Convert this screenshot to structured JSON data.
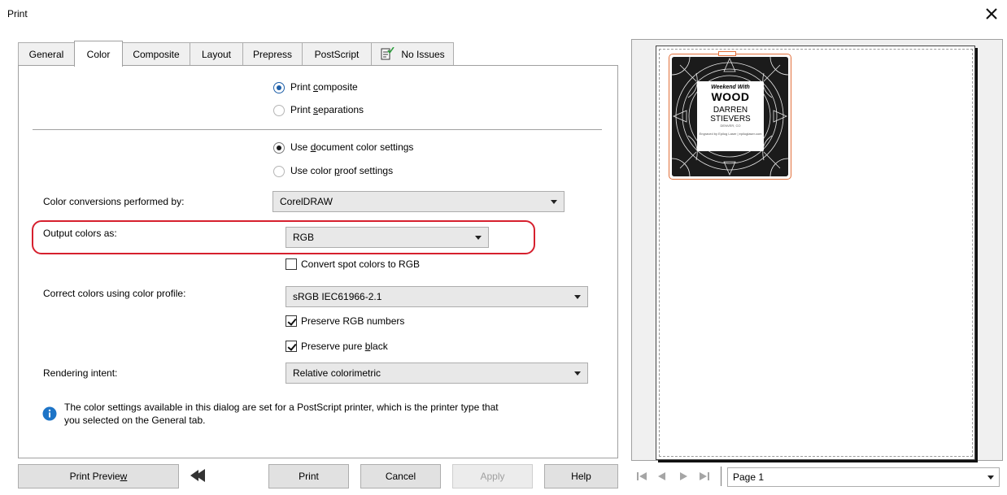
{
  "window": {
    "title": "Print",
    "close_icon": "close-icon"
  },
  "tabs": [
    {
      "label": "General",
      "active": false
    },
    {
      "label": "Color",
      "active": true
    },
    {
      "label": "Composite",
      "active": false
    },
    {
      "label": "Layout",
      "active": false
    },
    {
      "label": "Prepress",
      "active": false
    },
    {
      "label": "PostScript",
      "active": false
    },
    {
      "label": "No Issues",
      "active": false,
      "icon": "issues-check-icon"
    }
  ],
  "color_tab": {
    "print_mode": {
      "composite_pre": "Print ",
      "composite_u": "c",
      "composite_post": "omposite",
      "separations_pre": "Print ",
      "separations_u": "s",
      "separations_post": "eparations",
      "selected": "composite"
    },
    "settings_source": {
      "document_pre": "Use ",
      "document_u": "d",
      "document_post": "ocument color settings",
      "proof_pre": "Use color ",
      "proof_u": "p",
      "proof_post": "roof settings",
      "selected": "document"
    },
    "conversions_label": "Color conversions performed by:",
    "conversions_value": "CorelDRAW",
    "output_label": "Output colors as:",
    "output_value": "RGB",
    "convert_spot_label": "Convert spot colors to RGB",
    "convert_spot_checked": false,
    "profile_label": "Correct colors using color profile:",
    "profile_value": "sRGB IEC61966-2.1",
    "preserve_rgb_label": "Preserve RGB numbers",
    "preserve_rgb_checked": true,
    "preserve_black_pre": "Preserve pure ",
    "preserve_black_u": "b",
    "preserve_black_post": "lack",
    "preserve_black_checked": true,
    "intent_label": "Rendering intent:",
    "intent_value": "Relative colorimetric",
    "info_text_line1": "The color settings available in this dialog are set for a PostScript printer, which is the printer type that",
    "info_text_line2": "you selected on the General tab.",
    "info_icon": "info-icon"
  },
  "buttons": {
    "print_preview_pre": "Print Previe",
    "print_preview_u": "w",
    "collapse_icon": "collapse-preview-icon",
    "print": "Print",
    "cancel": "Cancel",
    "apply": "Apply",
    "help": "Help"
  },
  "preview": {
    "art_line1": "Weekend With",
    "art_line2": "WOOD",
    "art_line3": "DARREN",
    "art_line4": "STIEVERS",
    "art_line5": "DENVER, CO",
    "art_line6": "Engraved by Epilog Laser | epiloglaser.com",
    "page_value": "Page 1"
  },
  "colors": {
    "highlight": "#d6202e",
    "accent": "#1e5fa8",
    "artwork_border": "#e2703b"
  }
}
